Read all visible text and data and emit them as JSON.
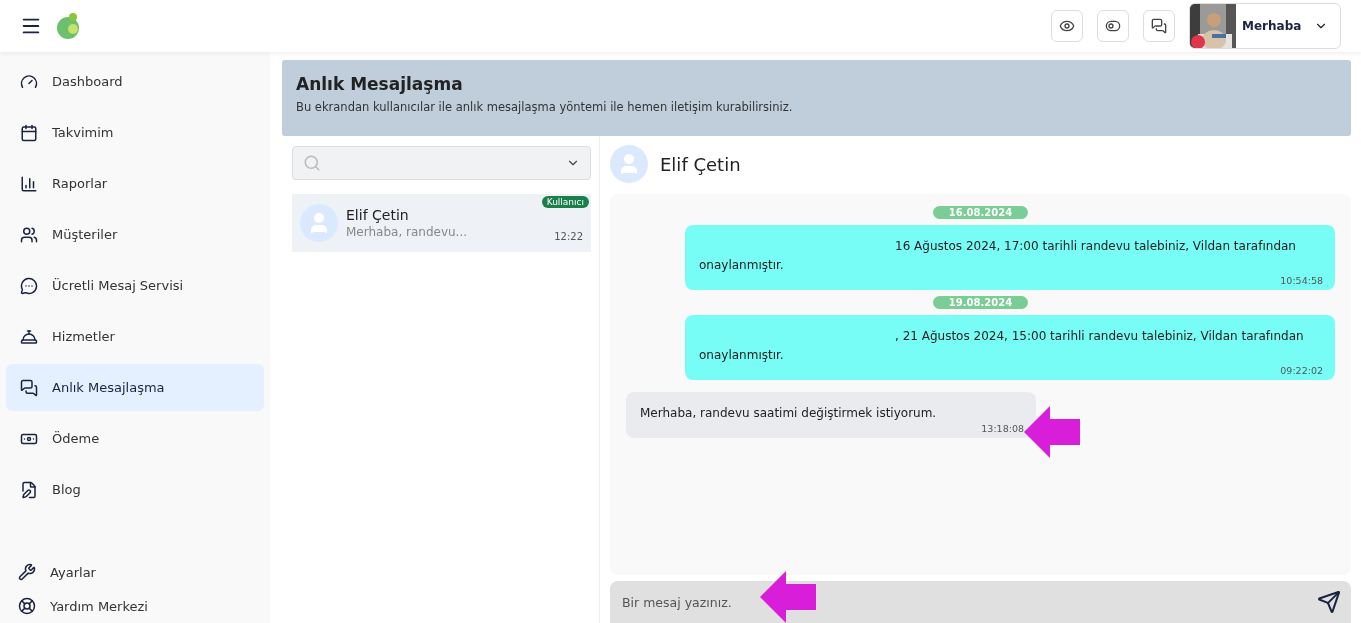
{
  "header": {
    "user_greeting": "Merhaba"
  },
  "sidebar": {
    "items": [
      {
        "label": "Dashboard",
        "selected": false
      },
      {
        "label": "Takvimim",
        "selected": false
      },
      {
        "label": "Raporlar",
        "selected": false
      },
      {
        "label": "Müşteriler",
        "selected": false
      },
      {
        "label": "Ücretli Mesaj Servisi",
        "selected": false
      },
      {
        "label": "Hizmetler",
        "selected": false
      },
      {
        "label": "Anlık Mesajlaşma",
        "selected": true
      },
      {
        "label": "Ödeme",
        "selected": false
      },
      {
        "label": "Blog",
        "selected": false
      }
    ],
    "bottom_items": [
      {
        "label": "Ayarlar"
      },
      {
        "label": "Yardım Merkezi"
      }
    ]
  },
  "banner": {
    "title": "Anlık Mesajlaşma",
    "subtitle": "Bu ekrandan kullanıcılar ile anlık mesajlaşma yöntemi ile hemen iletişim kurabilirsiniz."
  },
  "conversations": [
    {
      "name": "Elif Çetin",
      "preview": "Merhaba, randevu...",
      "time": "12:22",
      "badge": "Kullanıcı",
      "selected": true
    }
  ],
  "chat": {
    "contact": "Elif Çetin",
    "messages": [
      {
        "kind": "date",
        "text": "16.08.2024"
      },
      {
        "kind": "outgoing",
        "text": "16 Ağustos 2024, 17:00 tarihli randevu talebiniz, Vildan tarafından onaylanmıştır.",
        "time": "10:54:58"
      },
      {
        "kind": "date",
        "text": "19.08.2024"
      },
      {
        "kind": "outgoing",
        "text": ", 21 Ağustos 2024, 15:00 tarihli randevu talebiniz, Vildan tarafından onaylanmıştır.",
        "time": "09:22:02"
      },
      {
        "kind": "incoming",
        "text": "Merhaba, randevu saatimi değiştirmek istiyorum.",
        "time": "13:18:08"
      }
    ],
    "input": {
      "placeholder": "Bir mesaj yazınız."
    }
  }
}
